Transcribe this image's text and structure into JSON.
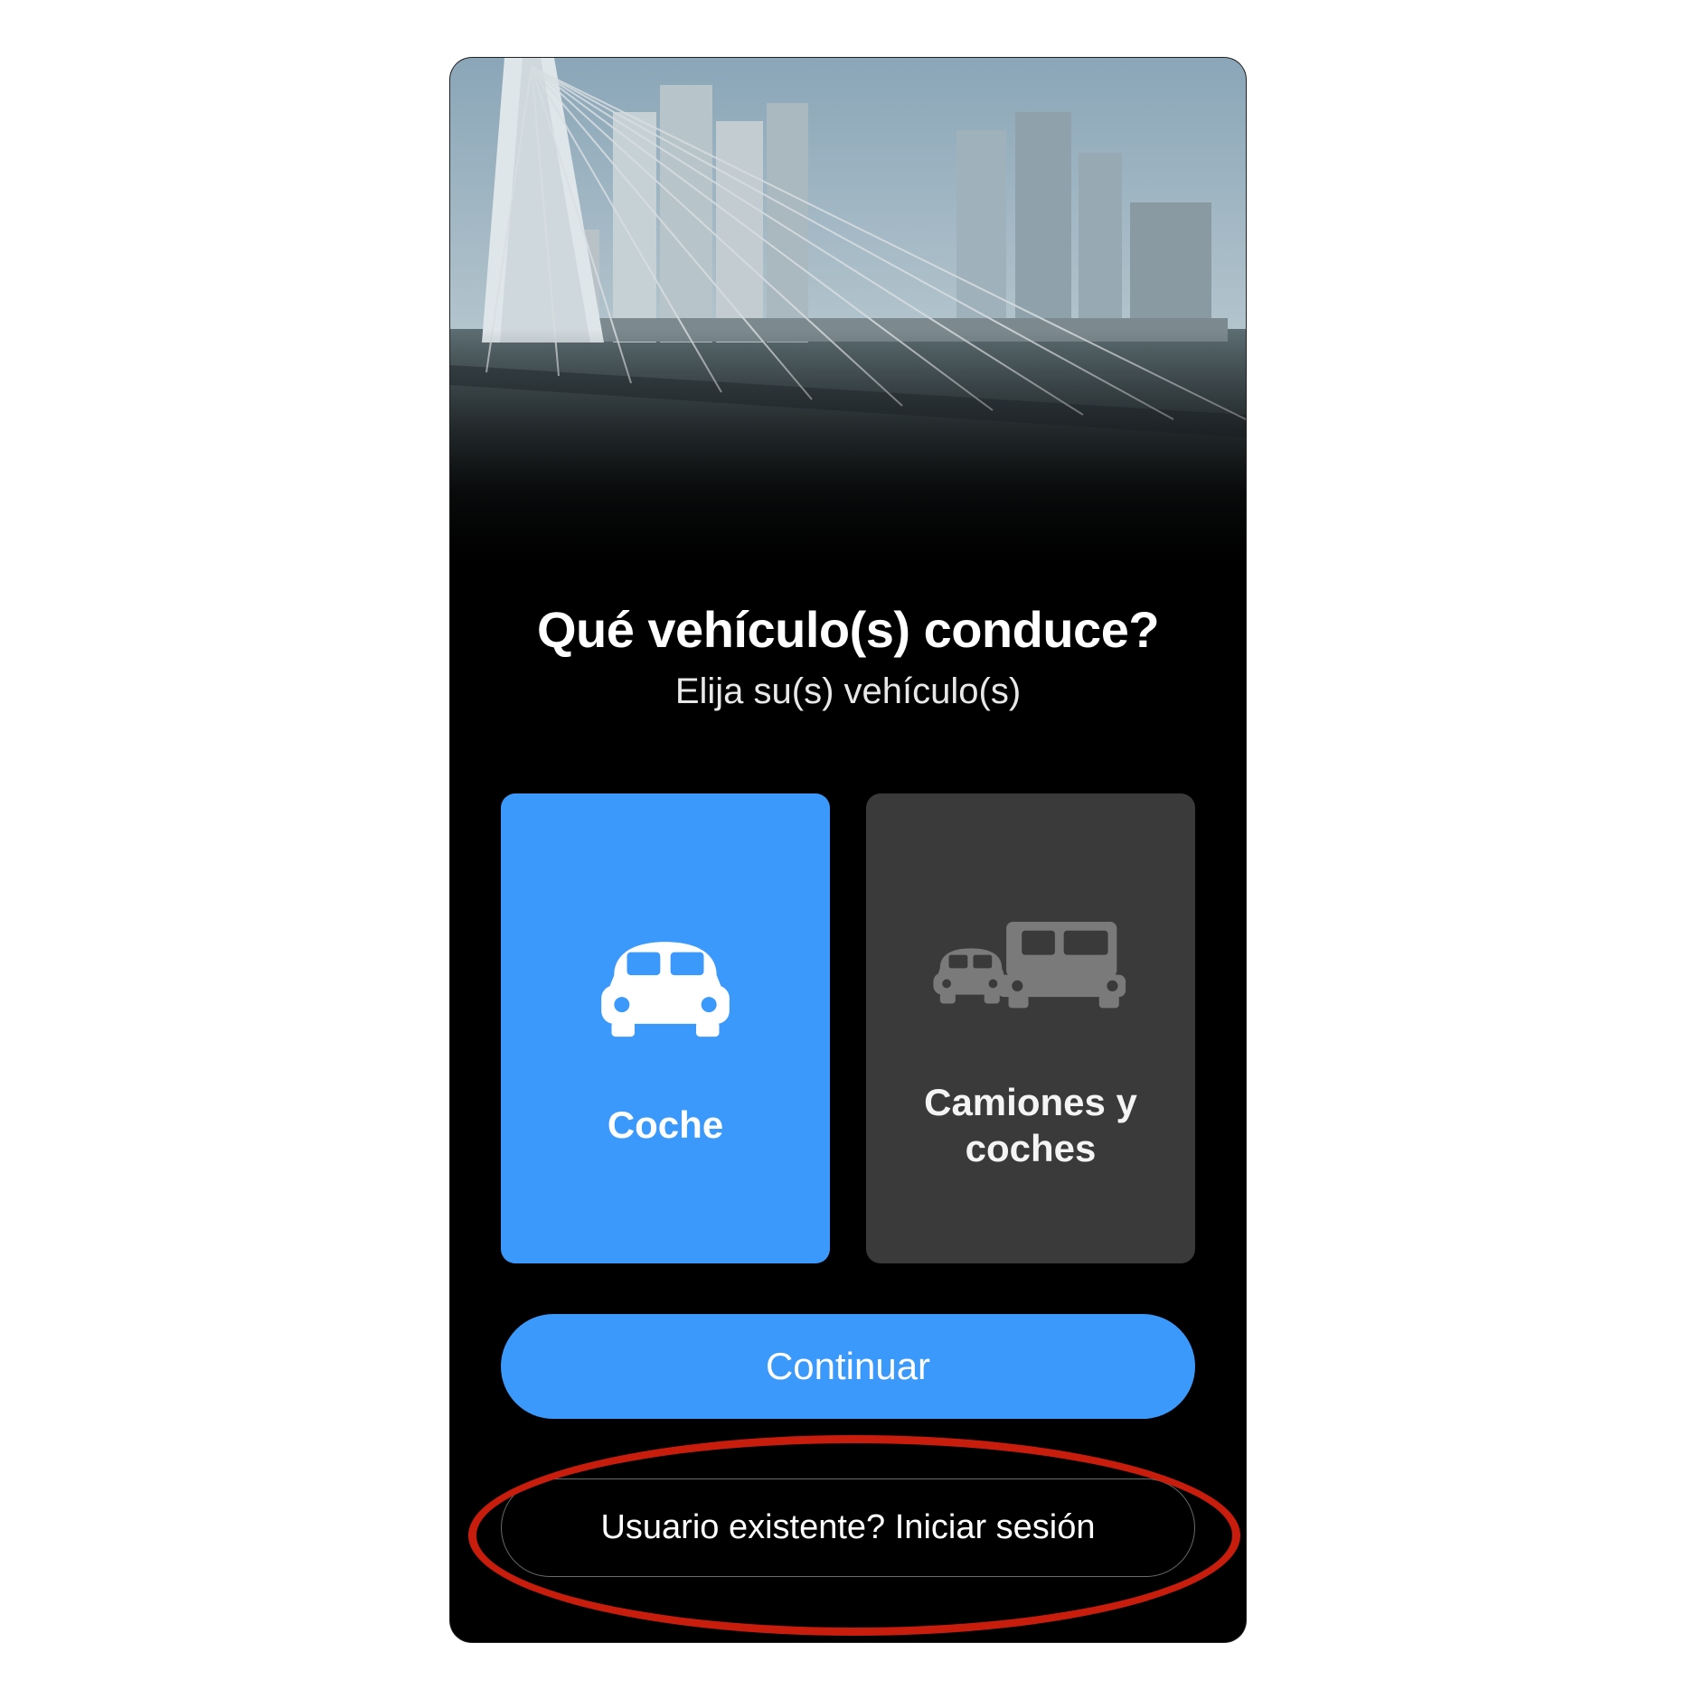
{
  "colors": {
    "accent": "#3b99fc",
    "card_unselected": "#3a3a3a",
    "annotation": "#c81c0c"
  },
  "header": {
    "title": "Qué vehículo(s) conduce?",
    "subtitle": "Elija su(s) vehículo(s)"
  },
  "vehicle_options": [
    {
      "id": "car",
      "label": "Coche",
      "icon": "car-icon",
      "selected": true
    },
    {
      "id": "trucks-cars",
      "label": "Camiones y coches",
      "icon": "car-truck-icon",
      "selected": false
    }
  ],
  "buttons": {
    "continue": "Continuar",
    "signin": "Usuario existente? Iniciar sesión"
  },
  "annotation": {
    "target": "signin-button",
    "shape": "ellipse"
  }
}
